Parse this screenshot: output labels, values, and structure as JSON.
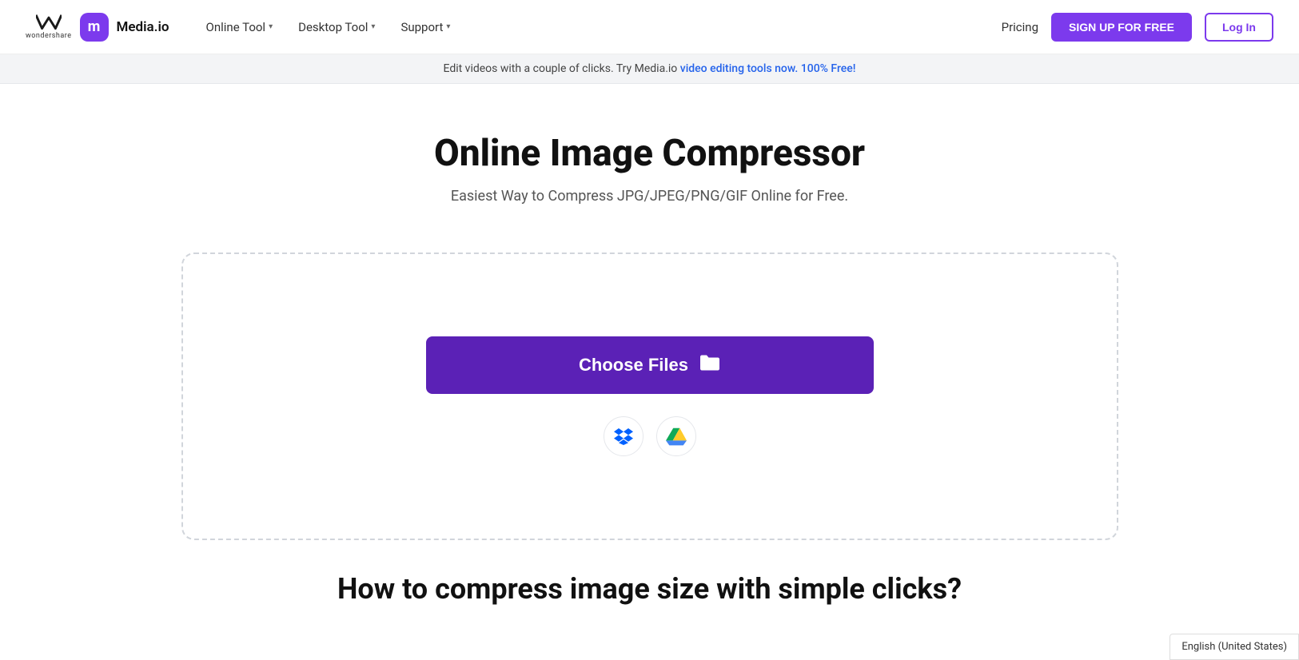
{
  "brand": {
    "wondershare_label": "wondershare",
    "mediaio_letter": "m",
    "mediaio_name": "Media.io"
  },
  "nav": {
    "links": [
      {
        "label": "Online Tool",
        "has_dropdown": true
      },
      {
        "label": "Desktop Tool",
        "has_dropdown": true
      },
      {
        "label": "Support",
        "has_dropdown": true
      }
    ],
    "pricing_label": "Pricing",
    "signup_label": "SIGN UP FOR FREE",
    "login_label": "Log In"
  },
  "banner": {
    "text": "Edit videos with a couple of clicks. Try Media.io ",
    "link_text": "video editing tools now. 100% Free!"
  },
  "hero": {
    "title": "Online Image Compressor",
    "subtitle": "Easiest Way to Compress JPG/JPEG/PNG/GIF Online for Free."
  },
  "upload": {
    "choose_files_label": "Choose Files",
    "dropbox_alt": "Dropbox",
    "gdrive_alt": "Google Drive"
  },
  "section": {
    "title": "How to compress image size with simple clicks?"
  },
  "footer": {
    "language": "English (United States)"
  }
}
